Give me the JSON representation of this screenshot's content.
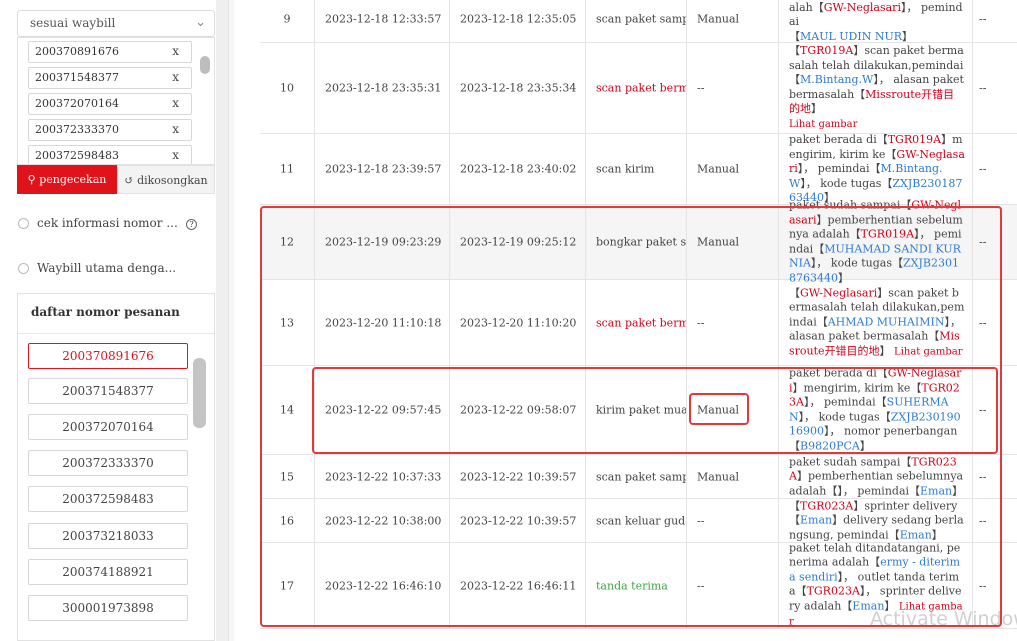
{
  "sidebar": {
    "filter_select": "sesuai waybill",
    "waybills": [
      "200370891676",
      "200371548377",
      "200372070164",
      "200372333370",
      "200372598483"
    ],
    "remove_label": "x",
    "search_button": "pengecekan",
    "clear_button": "dikosongkan",
    "radio_options": [
      "cek informasi nomor ...",
      "Waybill utama denga..."
    ],
    "help_glyph": "?",
    "order_list_title": "daftar nomor pesanan",
    "orders": [
      "200370891676",
      "200371548377",
      "200372070164",
      "200372333370",
      "200372598483",
      "200373218033",
      "200374188921",
      "300001973898"
    ],
    "selected_order": "200370891676"
  },
  "table": {
    "rows": [
      {
        "no": "9",
        "time1": "2023-12-18 12:33:57",
        "time2": "2023-12-18 12:35:05",
        "type": "scan paket sampai",
        "type_color": "normal",
        "source": "Manual",
        "last": "--"
      },
      {
        "no": "10",
        "time1": "2023-12-18 23:35:31",
        "time2": "2023-12-18 23:35:34",
        "type": "scan paket bermasalah",
        "type_color": "red",
        "source": "--",
        "last": "--"
      },
      {
        "no": "11",
        "time1": "2023-12-18 23:39:57",
        "time2": "2023-12-18 23:40:02",
        "type": "scan kirim",
        "type_color": "normal",
        "source": "Manual",
        "last": "--"
      },
      {
        "no": "12",
        "time1": "2023-12-19 09:23:29",
        "time2": "2023-12-19 09:25:12",
        "type": "bongkar paket sampai",
        "type_color": "normal",
        "source": "Manual",
        "last": "--"
      },
      {
        "no": "13",
        "time1": "2023-12-20 11:10:18",
        "time2": "2023-12-20 11:10:20",
        "type": "scan paket bermasalah",
        "type_color": "red",
        "source": "--",
        "last": "--"
      },
      {
        "no": "14",
        "time1": "2023-12-22 09:57:45",
        "time2": "2023-12-22 09:58:07",
        "type": "kirim paket muatan",
        "type_color": "normal",
        "source": "Manual",
        "last": "--"
      },
      {
        "no": "15",
        "time1": "2023-12-22 10:37:33",
        "time2": "2023-12-22 10:39:57",
        "type": "scan paket sampai",
        "type_color": "normal",
        "source": "Manual",
        "last": "--"
      },
      {
        "no": "16",
        "time1": "2023-12-22 10:38:00",
        "time2": "2023-12-22 10:39:57",
        "type": "scan keluar gudang",
        "type_color": "normal",
        "source": "--",
        "last": "--"
      },
      {
        "no": "17",
        "time1": "2023-12-22 16:46:10",
        "time2": "2023-12-22 16:46:11",
        "type": "tanda terima",
        "type_color": "green",
        "source": "--",
        "last": "--"
      }
    ],
    "descriptions": {
      "r9": {
        "a": "pemberhentian sebelumnya adalah",
        "b": "【",
        "c": "GW-Neglasari",
        "d": "】， pemindai",
        "e": "【",
        "f": "MAUL UDIN NUR",
        "g": "】"
      },
      "r10": {
        "a": "【",
        "b": "TGR019A",
        "c": "】scan paket bermasalah telah dilakukan,pemindai【",
        "d": "M.Bintang.W",
        "e": "】， alasan paket bermasalah【",
        "f": "Missroute开错目的地",
        "g": "】",
        "link": "Lihat gambar"
      },
      "r11": {
        "a": "paket berada di【",
        "b": "TGR019A",
        "c": "】mengirim, kirim ke【",
        "d": "GW-Neglasari",
        "e": "】， pemindai【",
        "f": "M.Bintang.W",
        "g": "】， kode tugas【",
        "h": "ZXJB23018763440",
        "i": "】"
      },
      "r12": {
        "a": "paket sudah sampai【",
        "b": "GW-Neglasari",
        "c": "】pemberhentian sebelumnya adalah【",
        "d": "TGR019A",
        "e": "】， pemindai【",
        "f": "MUHAMAD SANDI KURNIA",
        "g": "】， kode tugas【",
        "h": "ZXJB23018763440",
        "i": "】"
      },
      "r13": {
        "a": "【",
        "b": "GW-Neglasari",
        "c": "】scan paket bermasalah telah dilakukan,pemindai【",
        "d": "AHMAD MUHAIMIN",
        "e": "】， alasan paket bermasalah【",
        "f": "Missroute开错目的地",
        "g": "】",
        "link": "Lihat gambar"
      },
      "r14": {
        "a": "paket berada di【",
        "b": "GW-Neglasari",
        "c": "】mengirim, kirim ke【",
        "d": "TGR023A",
        "e": "】， pemindai【",
        "f": "SUHERMAN",
        "g": "】， kode tugas【",
        "h": "ZXJB23019016900",
        "i": "】， nomor penerbangan【",
        "j": "B9820PCA",
        "k": "】"
      },
      "r15": {
        "a": "paket sudah sampai【",
        "b": "TGR023A",
        "c": "】pemberhentian sebelumnya adalah【",
        "d": "】， pemindai【",
        "e": "Eman",
        "f": "】"
      },
      "r16": {
        "a": "【",
        "b": "TGR023A",
        "c": "】sprinter delivery【",
        "d": "Eman",
        "e": "】delivery sedang berlangsung, pemindai【",
        "f": "Eman",
        "g": "】"
      },
      "r17": {
        "a": "paket telah ditandatangani, penerima adalah【",
        "b": "ermy - diterima sendiri",
        "c": "】， outlet tanda terima【",
        "d": "TGR023A",
        "e": "】， sprinter delivery adalah【",
        "f": "Eman",
        "g": "】",
        "link": "Lihat gambar"
      }
    }
  },
  "os_watermark": "Activate Windows"
}
